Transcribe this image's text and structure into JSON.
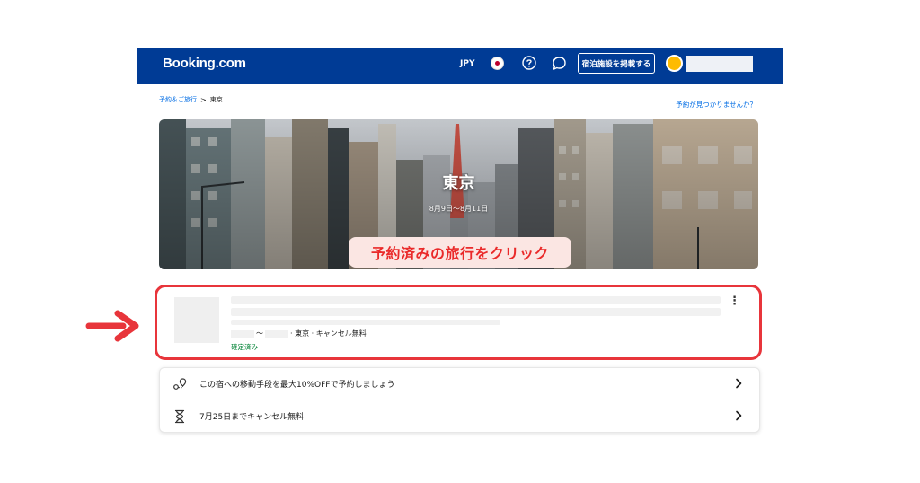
{
  "header": {
    "logo": "Booking.com",
    "currency": "JPY",
    "flag_icon": "japan-flag-icon",
    "help_icon": "question-circle-icon",
    "chat_icon": "chat-bubble-icon",
    "list_property_label": "宿泊施設を掲載する",
    "colors": {
      "background": "#003b95",
      "text": "#ffffff",
      "avatar": "#febb02"
    }
  },
  "breadcrumb": {
    "items": [
      "予約＆ご旅行",
      "東京"
    ],
    "separator": ">"
  },
  "not_found_link": "予約が見つかりませんか？",
  "hero": {
    "title": "東京",
    "dates": "8月9日〜8月11日"
  },
  "annotation": {
    "callout": "予約済みの旅行をクリック",
    "colors": {
      "highlight": "#e8353b",
      "callout_bg": "#fbe6e3",
      "callout_text": "#ea2a2a"
    }
  },
  "booking": {
    "date_separator": "〜",
    "summary": "· 東京 · キャンセル無料",
    "status": "確定済み",
    "status_color": "#008234"
  },
  "info_rows": [
    {
      "icon": "route-pin-icon",
      "text": "この宿への移動手段を最大10%OFFで予約しましょう"
    },
    {
      "icon": "hourglass-icon",
      "text": "7月25日までキャンセル無料"
    }
  ]
}
